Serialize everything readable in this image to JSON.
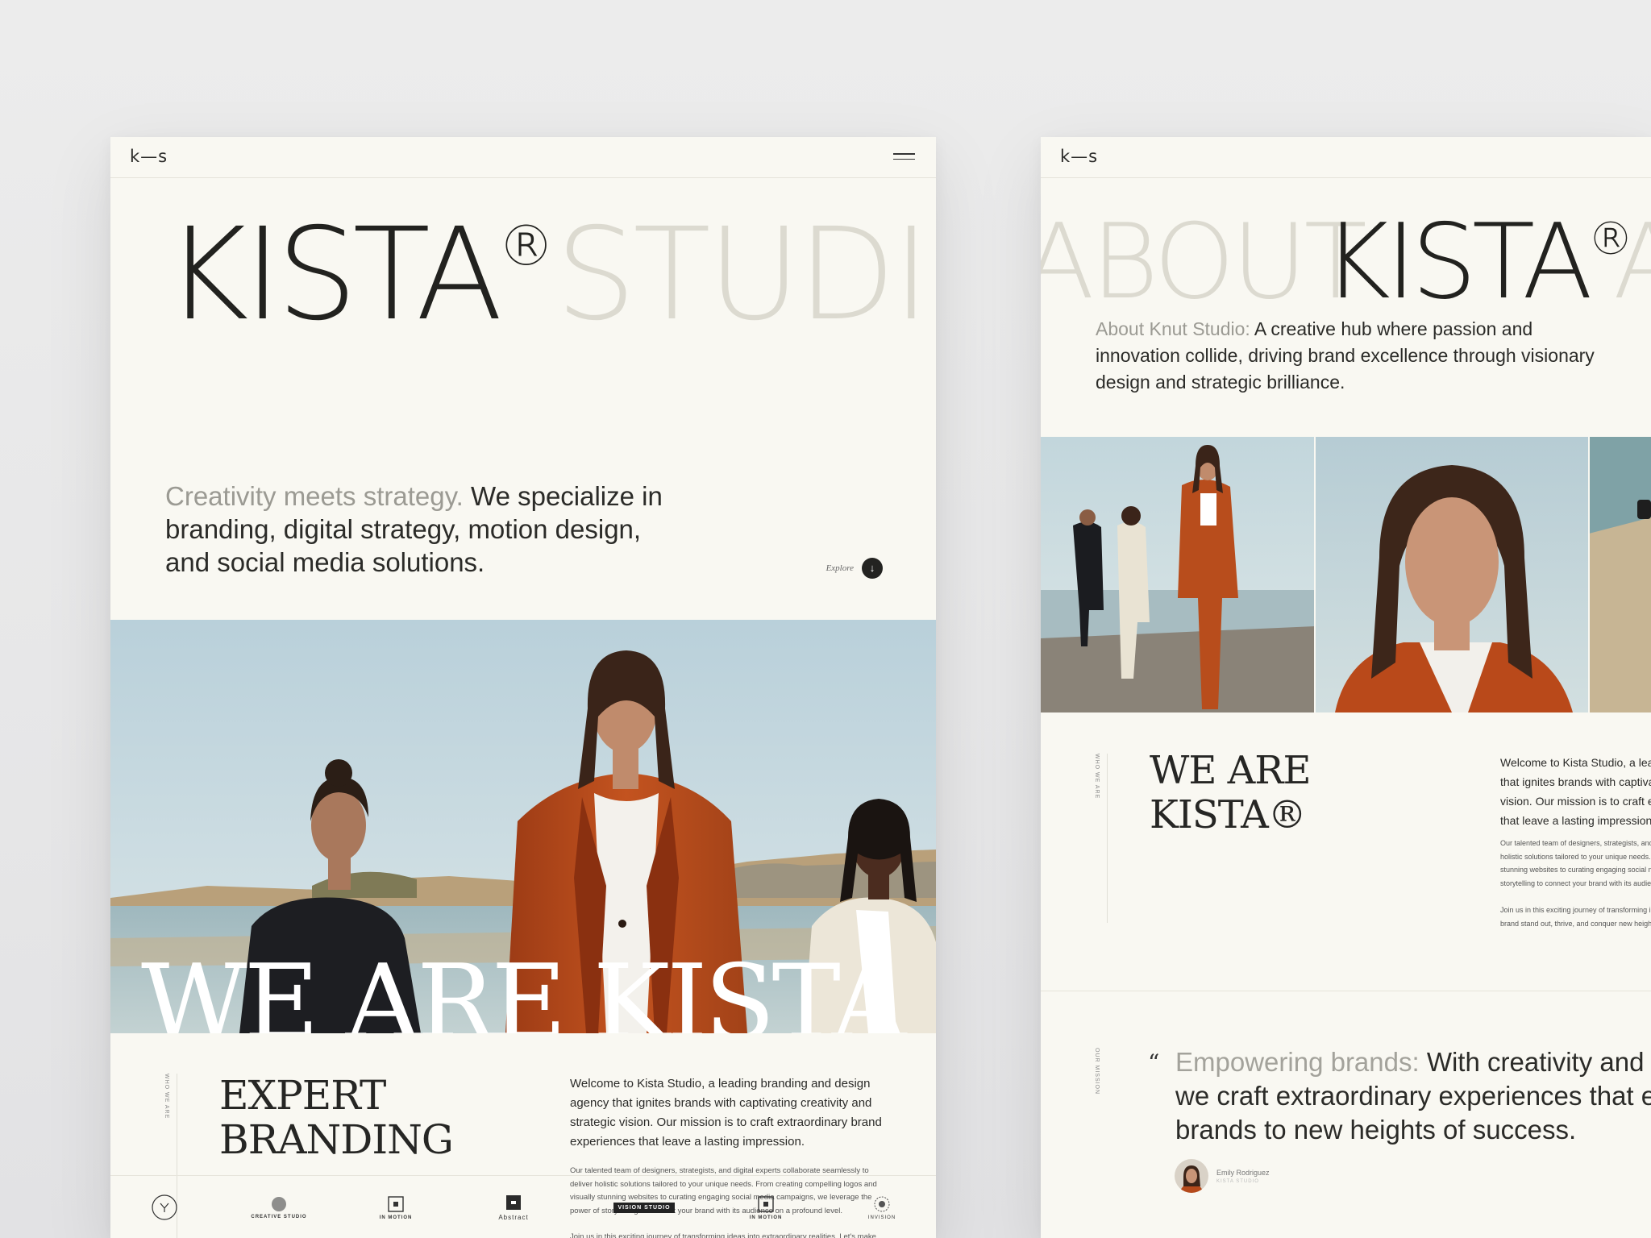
{
  "card_a": {
    "logo": "k—s",
    "hero_title": "KISTA",
    "hero_reg": "®",
    "hero_ghost": "STUDIO",
    "intro_muted": "Creativity meets strategy.",
    "intro_main": " We specialize in branding, digital strategy, motion design, and social media solutions.",
    "explore_label": "Explore",
    "explore_icon": "↓",
    "overlay_text": "WE ARE KISTA",
    "section_tag": "WHO WE ARE",
    "section_title_1": "EXPERT",
    "section_title_2": "BRANDING",
    "lead": "Welcome to Kista Studio, a leading branding and design agency that ignites brands with captivating creativity and strategic vision. Our mission is to craft extraordinary brand experiences that leave a lasting impression.",
    "small_1": "Our talented team of designers, strategists, and digital experts collaborate seamlessly to deliver holistic solutions tailored to your unique needs. From creating compelling logos and visually stunning websites to curating engaging social media campaigns, we leverage the power of storytelling to connect your brand with its audience on a profound level.",
    "small_2": "Join us in this exciting journey of transforming ideas into extraordinary realities. Let's make your brand stand out, thrive, and conquer new heights together.",
    "clients": [
      "",
      "CREATIVE STUDIO",
      "IN MOTION",
      "Abstract",
      "VISION STUDIO",
      "IN MOTION",
      "INVISION"
    ]
  },
  "card_b": {
    "logo": "k—s",
    "hero_ghost": "ABOUT",
    "hero_title": "KISTA",
    "hero_reg": "®",
    "hero_ghost_2": "A",
    "intro_muted": "About Knut Studio:",
    "intro_main": " A creative hub where passion and innovation collide, driving brand excellence through visionary design and strategic brilliance.",
    "section_tag": "WHO WE ARE",
    "section_title_1": "WE ARE",
    "section_title_2": "KISTA®",
    "lead": "Welcome to Kista Studio, a leading branding and design agency that ignites brands with captivating creativity and strategic vision. Our mission is to craft extraordinary brand experiences that leave a lasting impression.",
    "small_1": "Our talented team of designers, strategists, and digital experts collaborate seamlessly to deliver holistic solutions tailored to your unique needs. From creating compelling logos and visually stunning websites to curating engaging social media campaigns, we leverage the power of storytelling to connect your brand with its audience on a profound level.",
    "small_2": "Join us in this exciting journey of transforming ideas into extraordinary realities. Let's make your brand stand out, thrive, and conquer new heights together.",
    "mission_tag": "OUR MISSION",
    "quote_mark": "“",
    "quote_muted": "Empowering brands:",
    "quote_main": " With creativity and strategy, we craft extraordinary experiences that elevate brands to new heights of success.",
    "author_name": "Emily Rodriguez",
    "author_org": "KISTA STUDIO"
  },
  "colors": {
    "page": "#f9f8f2",
    "ink": "#22221f",
    "ghost": "#dcdad0",
    "muted": "#9b9a93",
    "orange": "#b5491c"
  }
}
